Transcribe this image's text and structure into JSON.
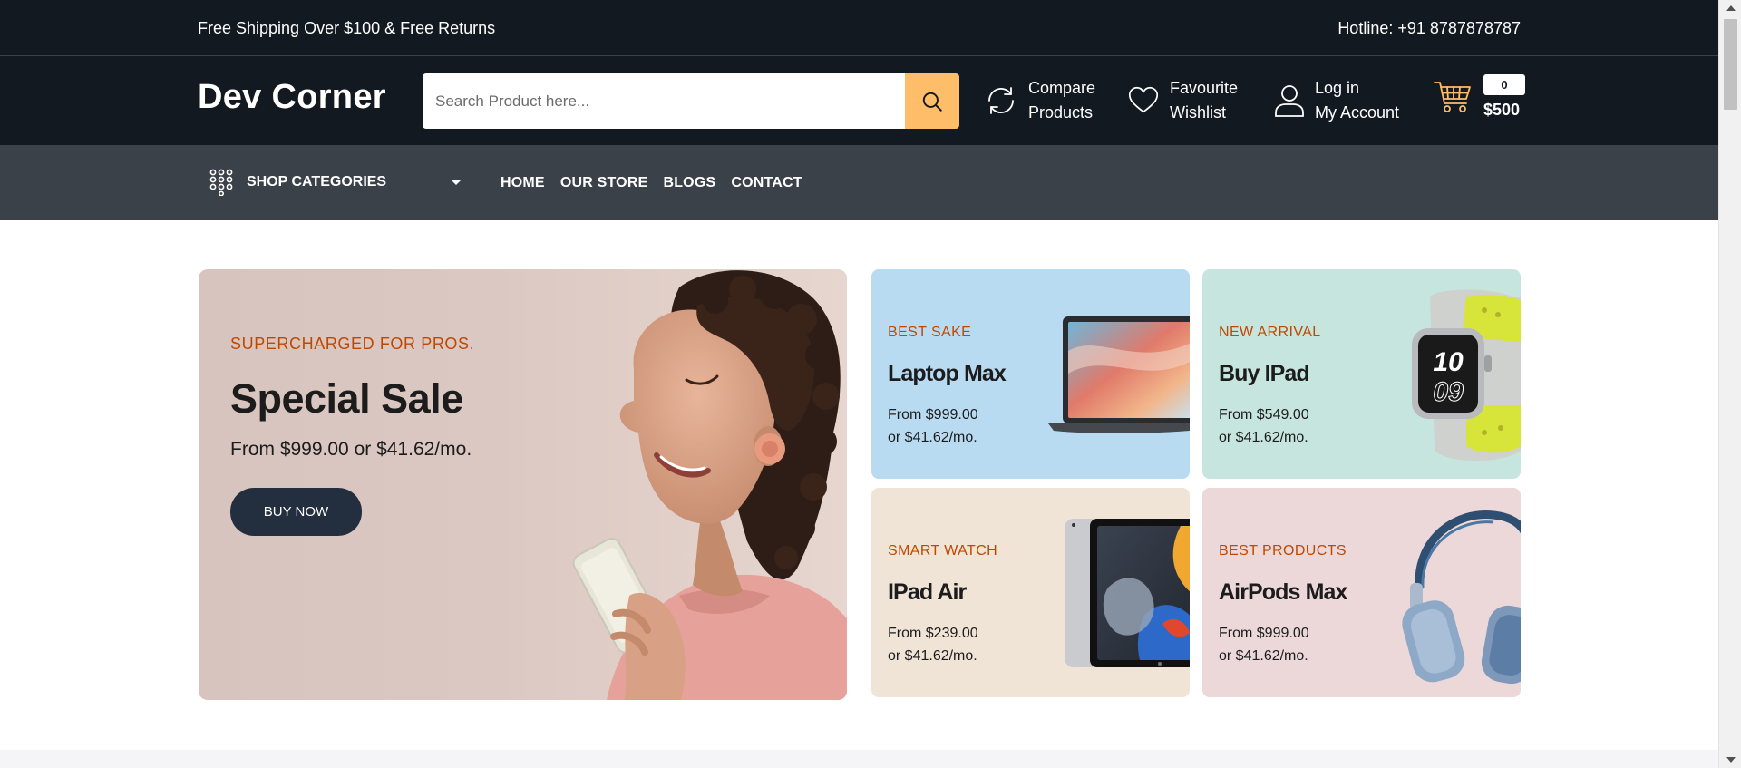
{
  "top_strip": {
    "shipping_text": "Free Shipping Over $100 & Free Returns",
    "hotline_text": "Hotline: +91 8787878787"
  },
  "header": {
    "logo": "Dev Corner",
    "search_placeholder": "Search Product here...",
    "search_icon": "search-icon",
    "compare": {
      "line1": "Compare",
      "line2": "Products",
      "icon": "compare-icon"
    },
    "wishlist": {
      "line1": "Favourite",
      "line2": "Wishlist",
      "icon": "heart-icon"
    },
    "account": {
      "line1": "Log in",
      "line2": "My Account",
      "icon": "user-icon"
    },
    "cart": {
      "count": "0",
      "total": "$500",
      "icon": "cart-icon"
    }
  },
  "navbar": {
    "categories_label": "SHOP CATEGORIES",
    "categories_icon": "grid-dots-icon",
    "menu": [
      "HOME",
      "OUR STORE",
      "BLOGS",
      "CONTACT"
    ]
  },
  "hero": {
    "main": {
      "kicker": "SUPERCHARGED FOR PROS.",
      "title": "Special Sale",
      "price": "From $999.00 or $41.62/mo.",
      "button": "BUY NOW"
    },
    "cards": [
      {
        "kicker": "BEST SAKE",
        "title": "Laptop Max",
        "price1": "From $999.00",
        "price2": "or $41.62/mo."
      },
      {
        "kicker": "NEW ARRIVAL",
        "title": "Buy IPad",
        "price1": "From $549.00",
        "price2": "or $41.62/mo."
      },
      {
        "kicker": "SMART WATCH",
        "title": "IPad Air",
        "price1": "From $239.00",
        "price2": "or $41.62/mo."
      },
      {
        "kicker": "BEST PRODUCTS",
        "title": "AirPods Max",
        "price1": "From $999.00",
        "price2": "or $41.62/mo."
      }
    ]
  },
  "colors": {
    "header_bg": "#131921",
    "nav_bg": "#3b4149",
    "accent": "#febd69",
    "kicker": "#bf4800",
    "button_bg": "#232f3e"
  }
}
